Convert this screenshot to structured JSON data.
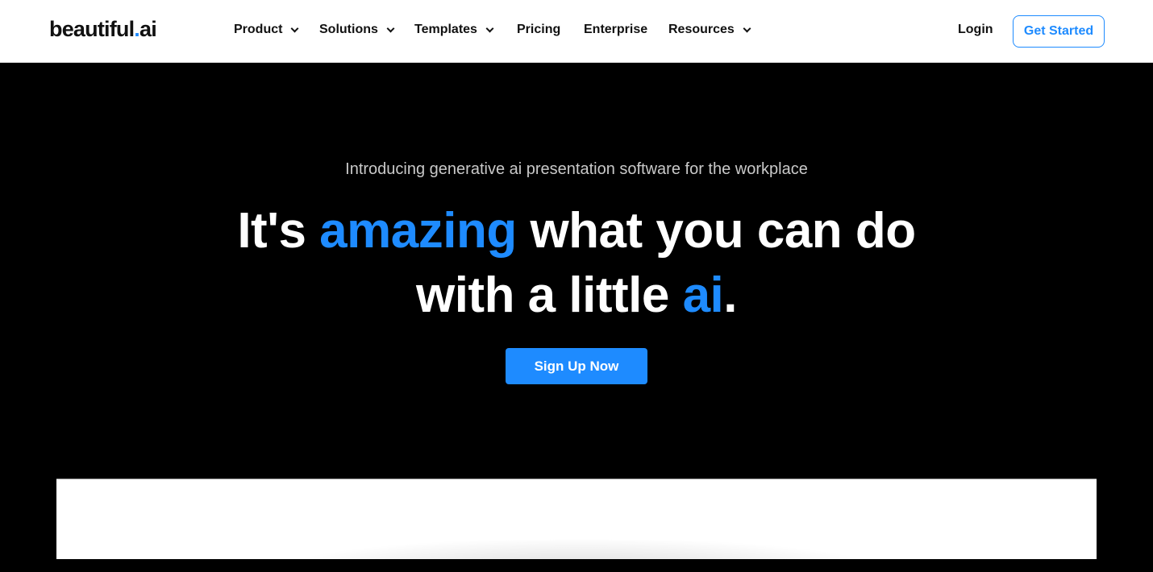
{
  "header": {
    "logo": {
      "text_main": "beautiful",
      "text_dot": ".",
      "text_suffix": "ai"
    },
    "nav": [
      {
        "label": "Product",
        "dropdown": true
      },
      {
        "label": "Solutions",
        "dropdown": true
      },
      {
        "label": "Templates",
        "dropdown": true
      },
      {
        "label": "Pricing",
        "dropdown": false
      },
      {
        "label": "Enterprise",
        "dropdown": false
      },
      {
        "label": "Resources",
        "dropdown": true
      }
    ],
    "login_label": "Login",
    "get_started_label": "Get Started"
  },
  "hero": {
    "subtitle": "Introducing generative ai presentation software for the workplace",
    "headline": {
      "part1": "It's ",
      "accent1": "amazing",
      "part2": " what you can do",
      "part3": "with a little ",
      "accent2": "ai",
      "part4": "."
    },
    "cta_label": "Sign Up Now"
  },
  "colors": {
    "accent": "#1e8bff",
    "hero_background": "#000000",
    "nav_background": "#ffffff"
  }
}
